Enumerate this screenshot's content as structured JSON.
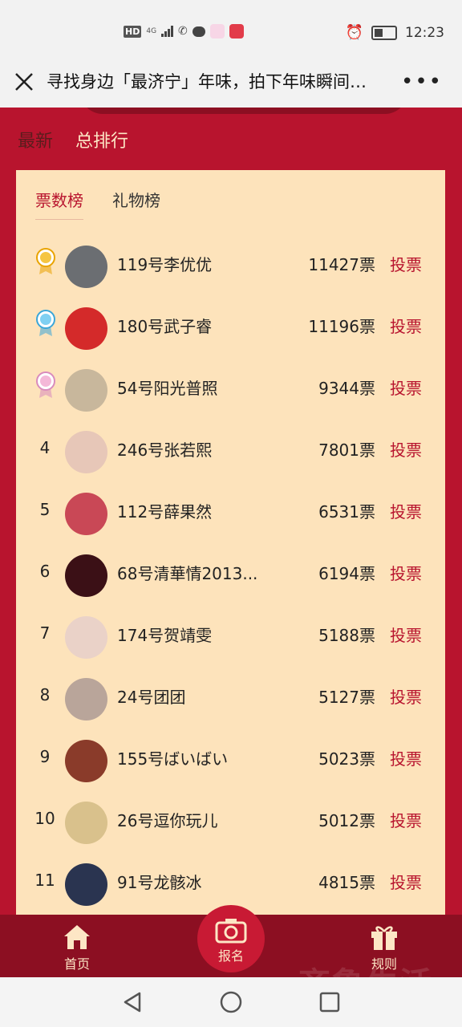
{
  "status_bar": {
    "hd": "HD",
    "network": "4G",
    "time": "12:23"
  },
  "title_bar": {
    "title": "寻找身边「最济宁」年味，拍下年味瞬间…",
    "more": "•••"
  },
  "tabs": {
    "latest": "最新",
    "total": "总排行"
  },
  "subtabs": {
    "votes": "票数榜",
    "gifts": "礼物榜"
  },
  "ranking": [
    {
      "rank": "",
      "medal": "gold",
      "name": "119号李优优",
      "votes": "11427票",
      "action": "投票"
    },
    {
      "rank": "",
      "medal": "blue",
      "name": "180号武子睿",
      "votes": "11196票",
      "action": "投票"
    },
    {
      "rank": "",
      "medal": "pink",
      "name": "54号阳光普照",
      "votes": "9344票",
      "action": "投票"
    },
    {
      "rank": "4",
      "medal": "",
      "name": "246号张若熙",
      "votes": "7801票",
      "action": "投票"
    },
    {
      "rank": "5",
      "medal": "",
      "name": "112号薛果然",
      "votes": "6531票",
      "action": "投票"
    },
    {
      "rank": "6",
      "medal": "",
      "name": "68号清華情2013...",
      "votes": "6194票",
      "action": "投票"
    },
    {
      "rank": "7",
      "medal": "",
      "name": "174号贺靖雯",
      "votes": "5188票",
      "action": "投票"
    },
    {
      "rank": "8",
      "medal": "",
      "name": "24号团团",
      "votes": "5127票",
      "action": "投票"
    },
    {
      "rank": "9",
      "medal": "",
      "name": "155号ばいばい",
      "votes": "5023票",
      "action": "投票"
    },
    {
      "rank": "10",
      "medal": "",
      "name": "26号逗你玩儿",
      "votes": "5012票",
      "action": "投票"
    },
    {
      "rank": "11",
      "medal": "",
      "name": "91号龙骸冰",
      "votes": "4815票",
      "action": "投票"
    }
  ],
  "bottom_nav": {
    "home": "首页",
    "signup": "报名",
    "rules": "规则"
  },
  "watermark": "齐鲁生活",
  "colors": {
    "primary": "#b8142e",
    "dark": "#8c0f22",
    "panel": "#fde3bb",
    "cream": "#fde6c5"
  },
  "icons": [
    "close-icon",
    "more-icon",
    "medal-icon",
    "home-icon",
    "camera-icon",
    "gift-icon",
    "back-icon",
    "home-circle-icon",
    "recents-icon"
  ]
}
